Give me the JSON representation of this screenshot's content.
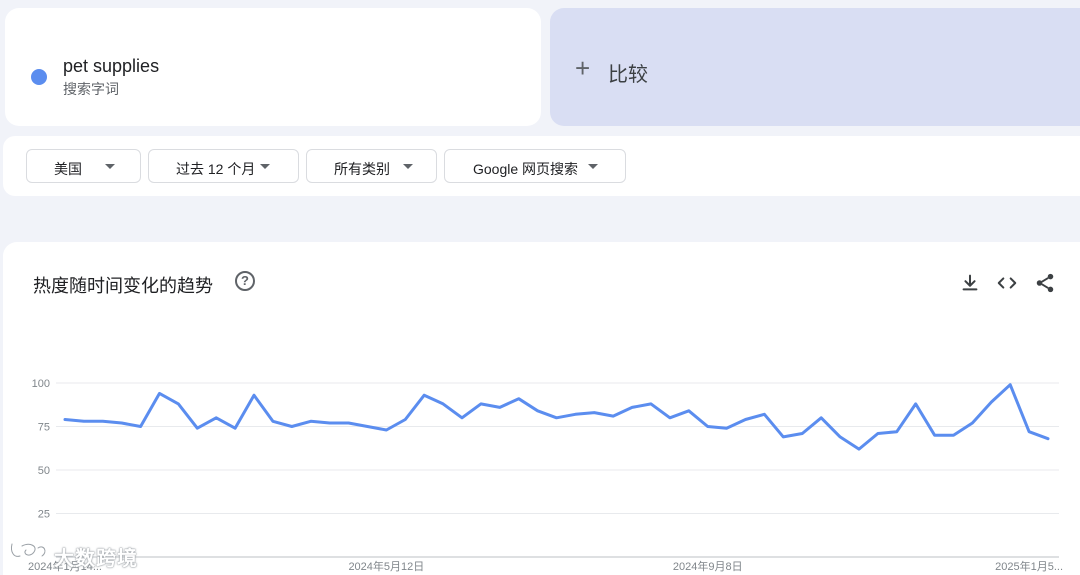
{
  "search_term": {
    "name": "pet supplies",
    "type": "搜索字词",
    "color": "#5b8def"
  },
  "compare": {
    "icon": "plus-icon",
    "label": "比较"
  },
  "filters": [
    {
      "label": "美国"
    },
    {
      "label": "过去 12 个月"
    },
    {
      "label": "所有类别"
    },
    {
      "label": "Google 网页搜索"
    }
  ],
  "chart_panel": {
    "title": "热度随时间变化的趋势",
    "help_icon": "?",
    "icons": [
      "download-icon",
      "embed-code-icon",
      "share-icon"
    ]
  },
  "watermark": "大数跨境",
  "chart_data": {
    "type": "line",
    "title": "",
    "xlabel": "",
    "ylabel": "",
    "ylim": [
      0,
      100
    ],
    "yticks": [
      25,
      50,
      75,
      100
    ],
    "xtick_labels": [
      "2024年1月14...",
      "2024年5月12日",
      "2024年9月8日",
      "2025年1月5..."
    ],
    "xtick_index": [
      0,
      17,
      34,
      52
    ],
    "grid": true,
    "line_color": "#5b8def",
    "series": [
      {
        "values": [
          79,
          78,
          78,
          77,
          75,
          94,
          88,
          74,
          80,
          74,
          93,
          78,
          75,
          78,
          77,
          77,
          75,
          73,
          79,
          93,
          88,
          80,
          88,
          86,
          91,
          84,
          80,
          82,
          83,
          81,
          86,
          88,
          80,
          84,
          75,
          74,
          79,
          82,
          69,
          71,
          80,
          69,
          62,
          71,
          72,
          88,
          70,
          70,
          77,
          89,
          99,
          72,
          68
        ]
      }
    ]
  }
}
